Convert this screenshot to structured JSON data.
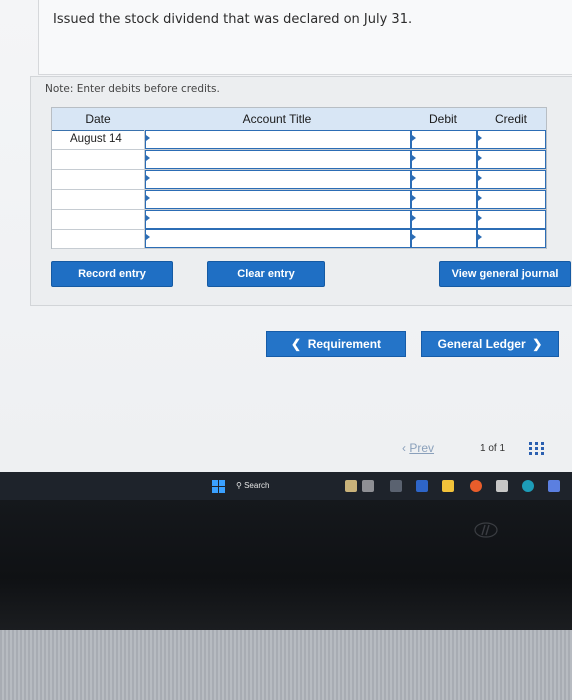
{
  "question": {
    "text": "Issued the stock dividend that was declared on July 31."
  },
  "note": "Note: Enter debits before credits.",
  "journal": {
    "headers": [
      "Date",
      "Account Title",
      "Debit",
      "Credit"
    ],
    "rows": [
      {
        "date": "August 14",
        "account": "",
        "debit": "",
        "credit": ""
      },
      {
        "date": "",
        "account": "",
        "debit": "",
        "credit": ""
      },
      {
        "date": "",
        "account": "",
        "debit": "",
        "credit": ""
      },
      {
        "date": "",
        "account": "",
        "debit": "",
        "credit": ""
      },
      {
        "date": "",
        "account": "",
        "debit": "",
        "credit": ""
      },
      {
        "date": "",
        "account": "",
        "debit": "",
        "credit": ""
      }
    ]
  },
  "buttons": {
    "record": "Record entry",
    "clear": "Clear entry",
    "view": "View general journal"
  },
  "nav": {
    "prev_label": "Requirement",
    "next_label": "General Ledger"
  },
  "pager": {
    "prev": "Prev",
    "position": "1 of 1"
  },
  "taskbar": {
    "search": "Search"
  },
  "colors": {
    "primary_button": "#1f6fc4",
    "table_header": "#d8e6f5",
    "input_border": "#2c6db5"
  }
}
